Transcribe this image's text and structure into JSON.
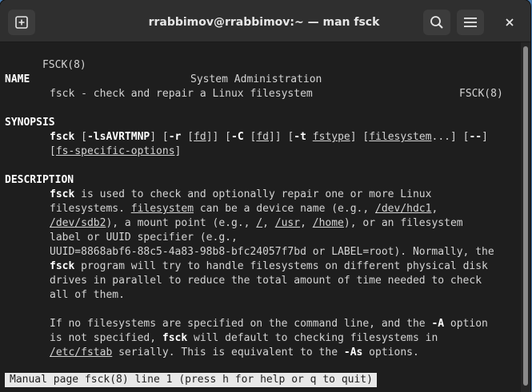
{
  "window": {
    "title": "rrabbimov@rrabbimov:~ — man fsck",
    "buttons": {
      "new_tab": "new-tab-icon",
      "search": "search-icon",
      "menu": "hamburger-menu-icon",
      "close": "close-icon"
    }
  },
  "man": {
    "header": {
      "left": "FSCK(8)",
      "center": "System Administration",
      "right": "FSCK(8)"
    },
    "name": {
      "heading": "NAME",
      "text": "fsck - check and repair a Linux filesystem"
    },
    "synopsis": {
      "heading": "SYNOPSIS",
      "line1": [
        {
          "t": "fsck",
          "s": "b"
        },
        {
          "t": " [",
          "s": ""
        },
        {
          "t": "-lsAVRTMNP",
          "s": "b"
        },
        {
          "t": "] [",
          "s": ""
        },
        {
          "t": "-r",
          "s": "b"
        },
        {
          "t": " [",
          "s": ""
        },
        {
          "t": "fd",
          "s": "u"
        },
        {
          "t": "]] [",
          "s": ""
        },
        {
          "t": "-C",
          "s": "b"
        },
        {
          "t": " [",
          "s": ""
        },
        {
          "t": "fd",
          "s": "u"
        },
        {
          "t": "]] [",
          "s": ""
        },
        {
          "t": "-t",
          "s": "b"
        },
        {
          "t": " ",
          "s": ""
        },
        {
          "t": "fstype",
          "s": "u"
        },
        {
          "t": "] [",
          "s": ""
        },
        {
          "t": "filesystem",
          "s": "u"
        },
        {
          "t": "...] [",
          "s": ""
        },
        {
          "t": "--",
          "s": "b"
        },
        {
          "t": "]",
          "s": ""
        }
      ],
      "line2": [
        {
          "t": "[",
          "s": ""
        },
        {
          "t": "fs-specific-options",
          "s": "u"
        },
        {
          "t": "]",
          "s": ""
        }
      ]
    },
    "description": {
      "heading": "DESCRIPTION",
      "para1": [
        [
          {
            "t": "fsck",
            "s": "b"
          },
          {
            "t": " is used to check and optionally repair one or more Linux",
            "s": ""
          }
        ],
        [
          {
            "t": "filesystems. ",
            "s": ""
          },
          {
            "t": "filesystem",
            "s": "u"
          },
          {
            "t": " can be a device name (e.g., ",
            "s": ""
          },
          {
            "t": "/dev/hdc1",
            "s": "u"
          },
          {
            "t": ",",
            "s": ""
          }
        ],
        [
          {
            "t": "/dev/sdb2",
            "s": "u"
          },
          {
            "t": "), a mount point (e.g., ",
            "s": ""
          },
          {
            "t": "/",
            "s": "u"
          },
          {
            "t": ", ",
            "s": ""
          },
          {
            "t": "/usr",
            "s": "u"
          },
          {
            "t": ", ",
            "s": ""
          },
          {
            "t": "/home",
            "s": "u"
          },
          {
            "t": "), or an filesystem",
            "s": ""
          }
        ],
        [
          {
            "t": "label or UUID specifier (e.g.,",
            "s": ""
          }
        ],
        [
          {
            "t": "UUID=8868abf6-88c5-4a83-98b8-bfc24057f7bd or LABEL=root). Normally, the",
            "s": ""
          }
        ],
        [
          {
            "t": "fsck",
            "s": "b"
          },
          {
            "t": " program will try to handle filesystems on different physical disk",
            "s": ""
          }
        ],
        [
          {
            "t": "drives in parallel to reduce the total amount of time needed to check",
            "s": ""
          }
        ],
        [
          {
            "t": "all of them.",
            "s": ""
          }
        ]
      ],
      "para2": [
        [
          {
            "t": "If no filesystems are specified on the command line, and the ",
            "s": ""
          },
          {
            "t": "-A",
            "s": "b"
          },
          {
            "t": " option",
            "s": ""
          }
        ],
        [
          {
            "t": "is not specified, ",
            "s": ""
          },
          {
            "t": "fsck",
            "s": "b"
          },
          {
            "t": " will default to checking filesystems in",
            "s": ""
          }
        ],
        [
          {
            "t": "/etc/fstab",
            "s": "u"
          },
          {
            "t": " serially. This is equivalent to the ",
            "s": ""
          },
          {
            "t": "-As",
            "s": "b"
          },
          {
            "t": " options.",
            "s": ""
          }
        ]
      ]
    }
  },
  "status_line": "Manual page fsck(8) line 1 (press h for help or q to quit)"
}
